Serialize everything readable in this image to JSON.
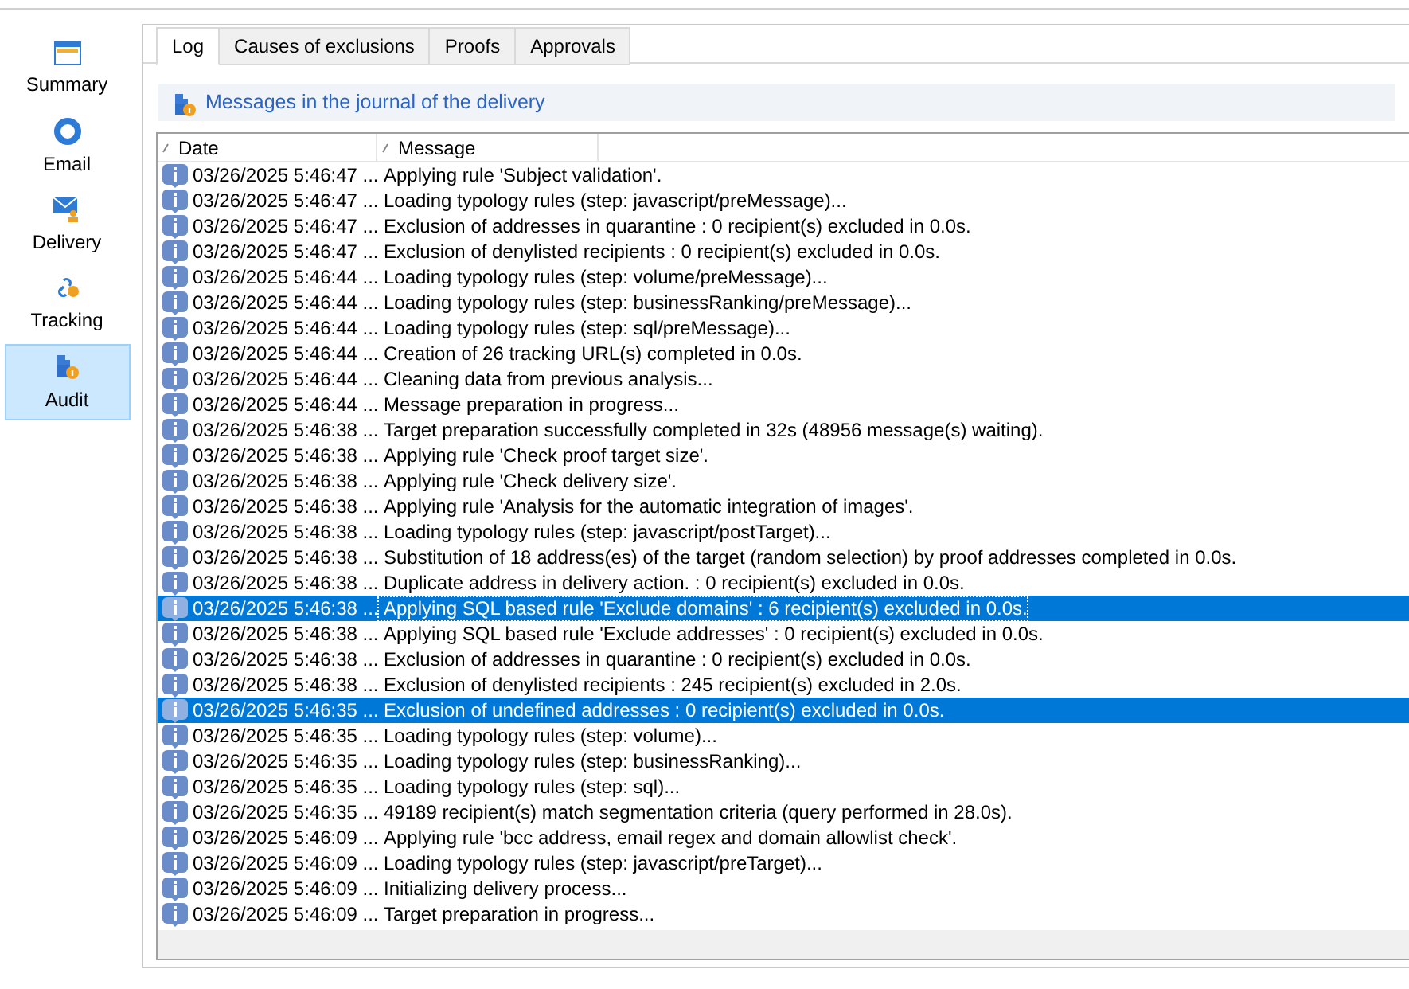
{
  "sidebar": {
    "items": [
      {
        "label": "Summary",
        "selected": false
      },
      {
        "label": "Email",
        "selected": false
      },
      {
        "label": "Delivery",
        "selected": false
      },
      {
        "label": "Tracking",
        "selected": false
      },
      {
        "label": "Audit",
        "selected": true
      }
    ]
  },
  "tabs": [
    {
      "label": "Log",
      "selected": true
    },
    {
      "label": "Causes of exclusions",
      "selected": false
    },
    {
      "label": "Proofs",
      "selected": false
    },
    {
      "label": "Approvals",
      "selected": false
    }
  ],
  "section_title": "Messages in the journal of the delivery",
  "table": {
    "columns": [
      "Date",
      "Message"
    ],
    "rows": [
      {
        "date": "03/26/2025 5:46:47 ...",
        "message": "Applying rule 'Subject validation'.",
        "selected": false
      },
      {
        "date": "03/26/2025 5:46:47 ...",
        "message": "Loading typology rules (step: javascript/preMessage)...",
        "selected": false
      },
      {
        "date": "03/26/2025 5:46:47 ...",
        "message": "Exclusion of addresses in quarantine : 0 recipient(s) excluded in 0.0s.",
        "selected": false
      },
      {
        "date": "03/26/2025 5:46:47 ...",
        "message": "Exclusion of denylisted recipients : 0 recipient(s) excluded in 0.0s.",
        "selected": false
      },
      {
        "date": "03/26/2025 5:46:44 ...",
        "message": "Loading typology rules (step: volume/preMessage)...",
        "selected": false
      },
      {
        "date": "03/26/2025 5:46:44 ...",
        "message": "Loading typology rules (step: businessRanking/preMessage)...",
        "selected": false
      },
      {
        "date": "03/26/2025 5:46:44 ...",
        "message": "Loading typology rules (step: sql/preMessage)...",
        "selected": false
      },
      {
        "date": "03/26/2025 5:46:44 ...",
        "message": "Creation of 26 tracking URL(s) completed in 0.0s.",
        "selected": false
      },
      {
        "date": "03/26/2025 5:46:44 ...",
        "message": "Cleaning data from previous analysis...",
        "selected": false
      },
      {
        "date": "03/26/2025 5:46:44 ...",
        "message": "Message preparation in progress...",
        "selected": false
      },
      {
        "date": "03/26/2025 5:46:38 ...",
        "message": "Target preparation successfully completed in 32s (48956 message(s) waiting).",
        "selected": false
      },
      {
        "date": "03/26/2025 5:46:38 ...",
        "message": "Applying rule 'Check proof target size'.",
        "selected": false
      },
      {
        "date": "03/26/2025 5:46:38 ...",
        "message": "Applying rule 'Check delivery size'.",
        "selected": false
      },
      {
        "date": "03/26/2025 5:46:38 ...",
        "message": "Applying rule 'Analysis for the automatic integration of images'.",
        "selected": false
      },
      {
        "date": "03/26/2025 5:46:38 ...",
        "message": "Loading typology rules (step: javascript/postTarget)...",
        "selected": false
      },
      {
        "date": "03/26/2025 5:46:38 ...",
        "message": "Substitution of 18 address(es) of the target (random selection) by proof addresses completed in 0.0s.",
        "selected": false
      },
      {
        "date": "03/26/2025 5:46:38 ...",
        "message": "Duplicate address in delivery action. : 0 recipient(s) excluded in 0.0s.",
        "selected": false
      },
      {
        "date": "03/26/2025 5:46:38 ...",
        "message": "Applying SQL based rule 'Exclude domains' : 6 recipient(s) excluded in 0.0s.",
        "selected": true,
        "focused": true
      },
      {
        "date": "03/26/2025 5:46:38 ...",
        "message": "Applying SQL based rule 'Exclude addresses' : 0 recipient(s) excluded in 0.0s.",
        "selected": false
      },
      {
        "date": "03/26/2025 5:46:38 ...",
        "message": "Exclusion of addresses in quarantine : 0 recipient(s) excluded in 0.0s.",
        "selected": false
      },
      {
        "date": "03/26/2025 5:46:38 ...",
        "message": "Exclusion of denylisted recipients : 245 recipient(s) excluded in 2.0s.",
        "selected": false
      },
      {
        "date": "03/26/2025 5:46:35 ...",
        "message": "Exclusion of undefined addresses : 0 recipient(s) excluded in 0.0s.",
        "selected": true
      },
      {
        "date": "03/26/2025 5:46:35 ...",
        "message": "Loading typology rules (step: volume)...",
        "selected": false
      },
      {
        "date": "03/26/2025 5:46:35 ...",
        "message": "Loading typology rules (step: businessRanking)...",
        "selected": false
      },
      {
        "date": "03/26/2025 5:46:35 ...",
        "message": "Loading typology rules (step: sql)...",
        "selected": false
      },
      {
        "date": "03/26/2025 5:46:35 ...",
        "message": "49189 recipient(s) match segmentation criteria (query performed in 28.0s).",
        "selected": false
      },
      {
        "date": "03/26/2025 5:46:09 ...",
        "message": "Applying rule 'bcc address, email regex and domain allowlist check'.",
        "selected": false
      },
      {
        "date": "03/26/2025 5:46:09 ...",
        "message": "Loading typology rules (step: javascript/preTarget)...",
        "selected": false
      },
      {
        "date": "03/26/2025 5:46:09 ...",
        "message": "Initializing delivery process...",
        "selected": false
      },
      {
        "date": "03/26/2025 5:46:09 ...",
        "message": "Target preparation in progress...",
        "selected": false
      }
    ]
  }
}
